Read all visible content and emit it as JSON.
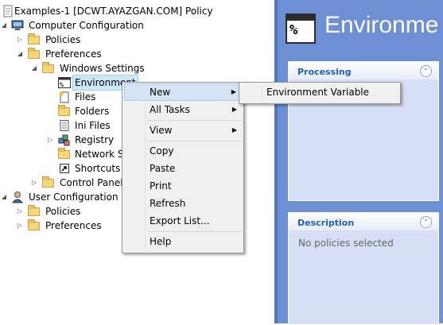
{
  "tree": {
    "root_title": "Examples-1 [DCWT.AYAZGAN.COM] Policy",
    "computer_config": "Computer Configuration",
    "policies": "Policies",
    "preferences": "Preferences",
    "windows_settings": "Windows Settings",
    "environment": "Environment",
    "files": "Files",
    "folders": "Folders",
    "ini_files": "Ini Files",
    "registry": "Registry",
    "network_shares": "Network Sh",
    "shortcuts": "Shortcuts",
    "control_panel": "Control Panel S",
    "user_config": "User Configuration",
    "user_policies": "Policies",
    "user_preferences": "Preferences",
    "icon_percent": "%"
  },
  "right_pane": {
    "title": "Environme",
    "icon_percent": "%",
    "processing_title": "Processing",
    "description_title": "Description",
    "description_text": "No policies selected",
    "collapse_glyph": "⌃"
  },
  "context_menu": {
    "new": "New",
    "all_tasks": "All Tasks",
    "view": "View",
    "copy": "Copy",
    "paste": "Paste",
    "print": "Print",
    "refresh": "Refresh",
    "export_list": "Export List...",
    "help": "Help",
    "submenu_arrow": "▶"
  },
  "submenu": {
    "environment_variable": "Environment Variable"
  },
  "colors": {
    "right_pane_bg": "#6d8fd4",
    "panel_title": "#215dc6",
    "highlight": "#d5e4f4"
  }
}
